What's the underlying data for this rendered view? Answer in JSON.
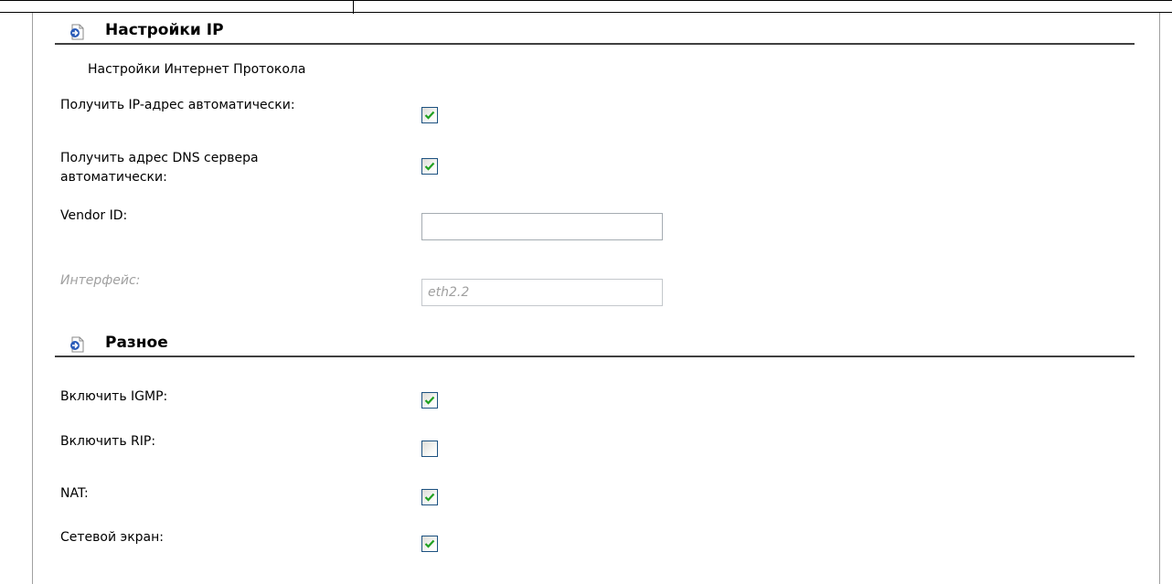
{
  "ip_section": {
    "title": "Настройки IP",
    "subtitle": "Настройки Интернет Протокола",
    "fields": [
      {
        "label": "Получить IP-адрес автоматически:",
        "checked": true
      },
      {
        "label": "Получить адрес DNS сервера автоматически:",
        "checked": true
      }
    ],
    "vendor_id": {
      "label": "Vendor ID:",
      "value": ""
    },
    "interface": {
      "label": "Интерфейс:",
      "value": "eth2.2",
      "disabled": true
    }
  },
  "misc_section": {
    "title": "Разное",
    "options": [
      {
        "label": "Включить IGMP:",
        "checked": true
      },
      {
        "label": "Включить RIP:",
        "checked": false
      },
      {
        "label": "NAT:",
        "checked": true
      },
      {
        "label": "Сетевой экран:",
        "checked": true
      }
    ]
  },
  "colors": {
    "checkmark": "#21a121",
    "checkbox_border": "#1c5180",
    "section_icon": "#2a5bb8"
  }
}
